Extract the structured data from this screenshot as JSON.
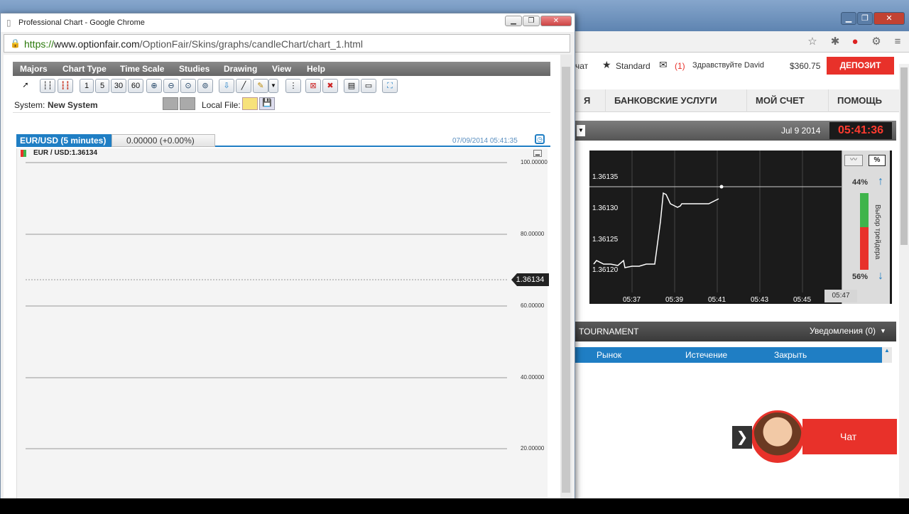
{
  "background": {
    "topbar": {
      "chat_short": "чат",
      "account_type": "Standard",
      "messages": "(1)",
      "greeting": "Здравствуйте David",
      "balance": "$360.75",
      "deposit": "ДЕПОЗИТ"
    },
    "nav": [
      "Я",
      "БАНКОВСКИЕ УСЛУГИ",
      "МОЙ СЧЕТ",
      "ПОМОЩЬ"
    ],
    "trade": {
      "date": "Jul 9 2014",
      "time": "05:41:36",
      "pct_up": "44%",
      "pct_down": "56%",
      "vote_label": "Выбор трейдера",
      "time_tag": "05:47",
      "pct_button": "%"
    },
    "mini_chart": {
      "y_ticks": [
        "1.36135",
        "1.36130",
        "1.36125",
        "1.36120"
      ],
      "x_ticks": [
        "05:37",
        "05:39",
        "05:41",
        "05:43",
        "05:45"
      ]
    },
    "tournament": "TOURNAMENT",
    "notifications": "Уведомления (0)",
    "table_headers": [
      "Рынок",
      "Истечение",
      "Закрыть"
    ],
    "chat_label": "Чат"
  },
  "popup": {
    "title": "Professional Chart - Google Chrome",
    "url_scheme": "https://",
    "url_host": "www.optionfair.com",
    "url_path": "/OptionFair/Skins/graphs/candleChart/chart_1.html",
    "menu": [
      "Majors",
      "Chart Type",
      "Time Scale",
      "Studies",
      "Drawing",
      "View",
      "Help"
    ],
    "timeframes": [
      "1",
      "5",
      "30",
      "60"
    ],
    "system_label": "System:",
    "system_value": "New System",
    "local_file": "Local File:",
    "tab_active": "EUR/USD (5 minutes)",
    "tab_inactive": "0.00000 (+0.00%)",
    "tab_date": "07/09/2014 05:41:35",
    "legend": "EUR / USD:1.36134",
    "price_tag": "1.36134",
    "y_ticks": [
      "100.00000",
      "80.00000",
      "60.00000",
      "40.00000",
      "20.00000"
    ]
  },
  "colors": {
    "accent_blue": "#1f7ec4",
    "deposit_red": "#e8312a"
  }
}
